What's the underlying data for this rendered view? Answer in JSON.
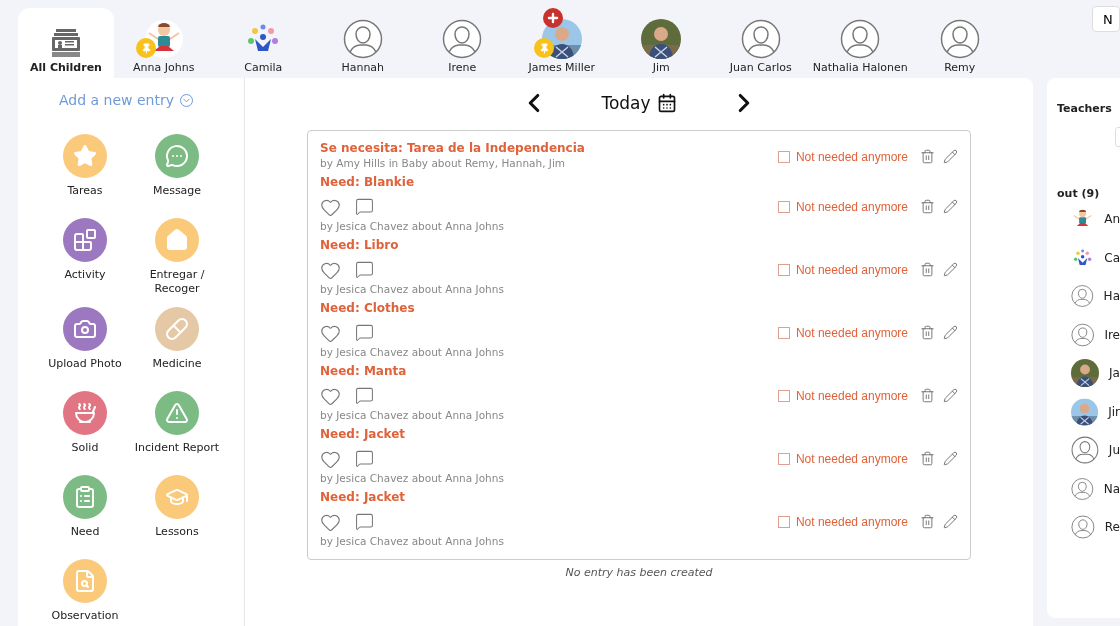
{
  "children_bar": {
    "tabs": [
      {
        "label": "All Children",
        "kind": "all",
        "selected": true,
        "pinned": false,
        "medical": false
      },
      {
        "label": "Anna Johns",
        "kind": "cartoon",
        "selected": false,
        "pinned": true,
        "medical": false
      },
      {
        "label": "Camila",
        "kind": "logo",
        "selected": false,
        "pinned": false,
        "medical": false
      },
      {
        "label": "Hannah",
        "kind": "silhouette",
        "selected": false,
        "pinned": false,
        "medical": false
      },
      {
        "label": "Irene",
        "kind": "silhouette",
        "selected": false,
        "pinned": false,
        "medical": false
      },
      {
        "label": "James Miller",
        "selected": false,
        "pinned": true,
        "medical": true
      },
      {
        "label": "Jim",
        "selected": false,
        "pinned": false,
        "medical": false
      },
      {
        "label": "Juan Carlos",
        "kind": "silhouette",
        "selected": false,
        "pinned": false,
        "medical": false
      },
      {
        "label": "Nathalia Halonen",
        "kind": "silhouette",
        "selected": false,
        "pinned": false,
        "medical": false
      },
      {
        "label": "Remy",
        "kind": "silhouette",
        "selected": false,
        "pinned": false,
        "medical": false
      }
    ],
    "corner_button": "N"
  },
  "entry_menu": {
    "title": "Add a new entry",
    "types": [
      {
        "label": "Tareas",
        "kind": "star",
        "color": "#fbc97a"
      },
      {
        "label": "Message",
        "kind": "message",
        "color": "#7dbb84"
      },
      {
        "label": "Activity",
        "kind": "blocks",
        "color": "#9b78bf"
      },
      {
        "label": "Entregar / Recoger",
        "kind": "home",
        "color": "#fbc97a"
      },
      {
        "label": "Upload Photo",
        "kind": "camera",
        "color": "#9b78bf"
      },
      {
        "label": "Medicine",
        "kind": "medicine",
        "color": "#e5c9a6"
      },
      {
        "label": "Solid",
        "kind": "bowl",
        "color": "#e27583"
      },
      {
        "label": "Incident Report",
        "kind": "alert",
        "color": "#7dbb84"
      },
      {
        "label": "Need",
        "kind": "checklist",
        "color": "#7dbb84"
      },
      {
        "label": "Lessons",
        "kind": "cap",
        "color": "#fbc97a"
      },
      {
        "label": "Observation",
        "kind": "observe",
        "color": "#fbc97a"
      }
    ]
  },
  "date_nav": {
    "label": "Today"
  },
  "entries": [
    {
      "title": "Se necesita: Tarea de la Independencia",
      "byline": "by Amy Hills in Baby about Remy, Hannah, Jim",
      "reactions": false,
      "checkbox": {
        "label": "Not needed anymore",
        "checked": false
      }
    },
    {
      "title": "Need: Blankie",
      "byline": "by Jesica Chavez about Anna Johns",
      "reactions": true,
      "checkbox": {
        "label": "Not needed anymore",
        "checked": false
      }
    },
    {
      "title": "Need: Libro",
      "byline": "by Jesica Chavez about Anna Johns",
      "reactions": true,
      "checkbox": {
        "label": "Not needed anymore",
        "checked": false
      }
    },
    {
      "title": "Need: Clothes",
      "byline": "by Jesica Chavez about Anna Johns",
      "reactions": true,
      "checkbox": {
        "label": "Not needed anymore",
        "checked": false
      }
    },
    {
      "title": "Need: Manta",
      "byline": "by Jesica Chavez about Anna Johns",
      "reactions": true,
      "checkbox": {
        "label": "Not needed anymore",
        "checked": false
      }
    },
    {
      "title": "Need: Jacket",
      "byline": "by Jesica Chavez about Anna Johns",
      "reactions": true,
      "checkbox": {
        "label": "Not needed anymore",
        "checked": false
      }
    },
    {
      "title": "Need: Jacket",
      "byline": "by Jesica Chavez about Anna Johns",
      "reactions": true,
      "checkbox": {
        "label": "Not needed anymore",
        "checked": false
      }
    }
  ],
  "empty_note": "No entry has been created",
  "side_panel": {
    "teachers_label": "Teachers",
    "out_label": "out (9)",
    "children": [
      {
        "name": "An",
        "kind": "cartoon"
      },
      {
        "name": "Ca",
        "kind": "logo"
      },
      {
        "name": "Ha",
        "kind": "silhouette"
      },
      {
        "name": "Ire",
        "kind": "silhouette"
      },
      {
        "name": "Ja"
      },
      {
        "name": "Jir"
      },
      {
        "name": "Ju",
        "kind": "silhouette"
      },
      {
        "name": "Na",
        "kind": "silhouette"
      },
      {
        "name": "Re",
        "kind": "silhouette"
      }
    ]
  }
}
